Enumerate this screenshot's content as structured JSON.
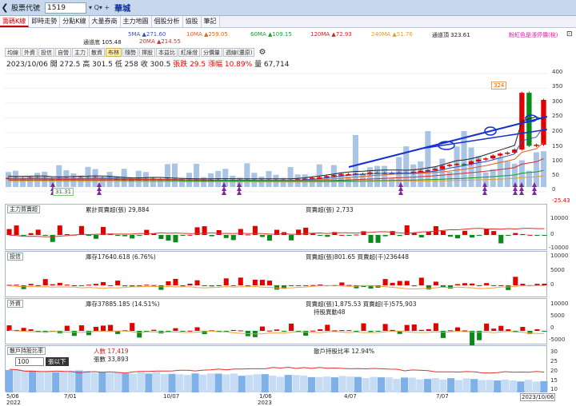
{
  "header": {
    "back_icon": "chevron-left-icon",
    "title": "股票代號",
    "code": "1519",
    "controls": "▾ Q▾ +",
    "stock_name": "華城"
  },
  "tabs": [
    "籌碼K線",
    "即時走勢",
    "分點K線",
    "大量券商",
    "主力地圖",
    "個股分析",
    "協股",
    "筆記"
  ],
  "legend": {
    "ma5": "5MA ▲271.60",
    "ma10": "10MA ▲259.05",
    "ma60": "60MA ▲109.15",
    "ma120": "120MA ▲72.93",
    "ma240": "240MA ▲51.76",
    "upper": "通道頂 323.61",
    "lower": "通道底 105.48",
    "ma20": "20MA ▲214.55",
    "note": "粉紅色是漲停價(稅)"
  },
  "subtabs": [
    "均線",
    "外資",
    "投信",
    "自營",
    "主力",
    "散資",
    "布林",
    "隨勢",
    "擇股",
    "本益比",
    "紅綠燈",
    "分價量",
    "週線(還原)"
  ],
  "price_info": {
    "date": "2023/10/06",
    "open": "開 272.5",
    "high": "高 301.5",
    "low": "低 258",
    "close": "收 300.5",
    "change": "張跌 29.5",
    "pct": "漲幅 10.89%",
    "volume": "量 67,714"
  },
  "price_chart": {
    "y_ticks": [
      "400",
      "350",
      "300",
      "250",
      "200",
      "150",
      "100",
      "50",
      "0"
    ],
    "low_label": "-25.43",
    "hi_tag": "324",
    "lo_tag": "31.31"
  },
  "panel_main": {
    "dropdown": "主力買賣超",
    "left": "累計買賣超(張) 29,884",
    "right": "買賣超(張) 2,733",
    "ticks": [
      "10000",
      "0",
      "-10000"
    ]
  },
  "panel_trust": {
    "dropdown": "投信",
    "left": "庫存17640.618 (6.76%)",
    "right": "買賣超(張)801.65 買賣超(千)236448",
    "ticks": [
      "10000",
      "5000",
      "0"
    ]
  },
  "panel_foreign": {
    "dropdown": "外資",
    "left": "庫存37885.185 (14.51%)",
    "right": "買賣超(張)1,875.53 買賣超(千)575,903",
    "right2": "持股異動48",
    "ticks": [
      "10000",
      "5000",
      "0",
      "-5000"
    ]
  },
  "panel_holders": {
    "dropdown": "散戶持股比率",
    "left": "人數 17,419",
    "left2": "張數 33,893",
    "right": "散戶持股比率 12.94%",
    "lots_value": "100",
    "lots_label": "張以下",
    "ticks": [
      "30",
      "25",
      "20",
      "15",
      "10"
    ]
  },
  "xaxis": {
    "labels": [
      "5/06",
      "7/01",
      "10/07",
      "1/06",
      "4/07",
      "7/07",
      "2023/10/06"
    ],
    "years": [
      "2022",
      "2023"
    ]
  },
  "colors": {
    "up": "#e00000",
    "down": "#0a8a1a",
    "volume": "#a9c4e4",
    "trend": "#1530d0"
  }
}
